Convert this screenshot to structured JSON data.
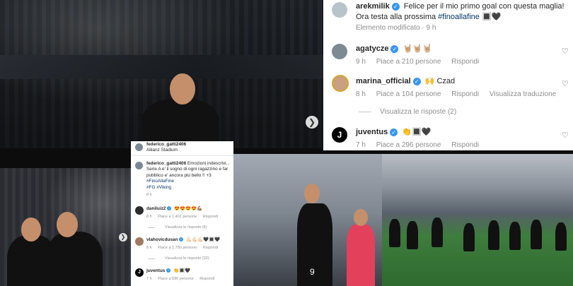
{
  "large_card": {
    "post": {
      "username": "arekmilik",
      "text_line1": "Felice per il mio primo goal con questa maglia!",
      "text_line2_prefix": "Ora testa alla prossima ",
      "hashtag": "#finoallafine",
      "emoji": "🔳🖤",
      "meta": "Elemento modificato · 9 h"
    },
    "comments": [
      {
        "username": "agatycze",
        "text": "🤘🏼🤘🏼🤘🏼",
        "time": "9 h",
        "likes": "Piace a 210 persone",
        "reply": "Rispondi"
      },
      {
        "username": "marina_official",
        "text": "🙌 Czad",
        "time": "8 h",
        "likes": "Piace a 104 persone",
        "reply": "Rispondi",
        "translate": "Visualizza traduzione"
      },
      {
        "username": "juventus",
        "text": "👏🔳🖤",
        "time": "7 h",
        "likes": "Piace a 296 persone",
        "reply": "Rispondi"
      }
    ],
    "view_replies": "Visualizza le risposte (2)"
  },
  "small_card": {
    "location_user": "federico_gatti2406",
    "location": "Allianz Stadium",
    "post": {
      "username": "federico_gatti2406",
      "lines": [
        "Emozioni indescrivi...",
        "Serie A e' il sogno di ogni ragazzino e far",
        "pubblico e' ancora più bello !! +3",
        "#FinoAllaFine",
        "#FG #Viking"
      ],
      "time": "8 h"
    },
    "comments": [
      {
        "username": "daniluiz2",
        "text": "😍😍😍😍💪🏽",
        "time": "8 h",
        "likes": "Piace a 1.401 persone",
        "reply": "Rispondi",
        "replies": "Visualizza le risposte (6)"
      },
      {
        "username": "vlahovicdusan",
        "text": "💪🏻💪🏻💪🏻🖤🔳🖤",
        "time": "8 h",
        "likes": "Piace a 1.790 persone",
        "reply": "Rispondi",
        "replies": "Visualizza le risposte (32)"
      },
      {
        "username": "juventus",
        "text": "👏🔳🖤",
        "time": "7 h",
        "likes": "Piace a 590 persone",
        "reply": "Rispondi"
      }
    ]
  },
  "photos": {
    "stadium_banner": "Allianz Stadium",
    "player_number": "9"
  },
  "icons": {
    "carousel_arrow": "chevron-right-icon",
    "like": "heart-outline-icon",
    "verified": "verified-badge-icon"
  },
  "colors": {
    "verified_blue": "#3897f0",
    "link_blue": "#00376b",
    "meta_grey": "#8e8e8e",
    "referee_pink": "#e3415b",
    "pitch_green": "#2f6a2f"
  }
}
